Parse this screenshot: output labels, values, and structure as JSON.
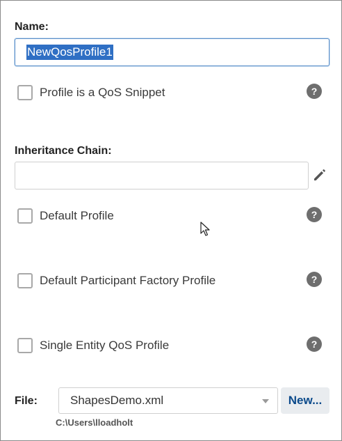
{
  "name_field": {
    "label": "Name:",
    "value": "NewQosProfile1"
  },
  "snippet": {
    "label": "Profile is a QoS Snippet",
    "checked": false
  },
  "inheritance": {
    "label": "Inheritance Chain:",
    "value": ""
  },
  "default_profile": {
    "label": "Default Profile",
    "checked": false
  },
  "default_participant_factory": {
    "label": "Default Participant Factory Profile",
    "checked": false
  },
  "single_entity": {
    "label": "Single Entity QoS Profile",
    "checked": false
  },
  "help_glyph": "?",
  "file": {
    "label": "File:",
    "selected": "ShapesDemo.xml",
    "new_button": "New...",
    "path": "C:\\Users\\lloadholt"
  },
  "icons": {
    "help": "help-icon",
    "edit": "pencil-icon",
    "dropdown": "chevron-down-icon",
    "cursor": "mouse-pointer-icon"
  },
  "colors": {
    "selection": "#2f6fc4",
    "focus_border": "#5b8fc9",
    "help_bg": "#6e6e6e",
    "new_button_text": "#0b4a8b"
  }
}
